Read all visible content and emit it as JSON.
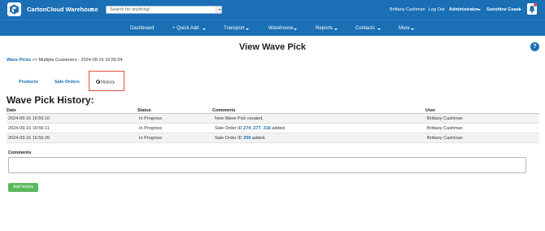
{
  "app": {
    "brand": "CartonCloud Warehouse",
    "logo_icon": "cartoncloud-cube-logo",
    "accent_color": "#1a6fb5"
  },
  "search": {
    "placeholder": "Search for anything!"
  },
  "topbar": {
    "user": "Brittany Cashman",
    "logout": "Log Out",
    "role": "Administrator",
    "warehouse": "Sunshine Coast",
    "notification_icon": "bell-icon"
  },
  "nav": {
    "dashboard": "Dashboard",
    "quick_add": "+ Quick Add",
    "transport": "Transport",
    "warehouse": "Warehouse",
    "reports": "Reports",
    "contacts": "Contacts",
    "more": "More"
  },
  "page": {
    "title": "View Wave Pick",
    "help": "?"
  },
  "breadcrumb": {
    "link": "Wave Picks",
    "separator": ">>",
    "current": "Multiple Customers - 2024-09-16 16:55:54"
  },
  "tabs": {
    "products": "Products",
    "sale_orders": "Sale Orders",
    "history": "History",
    "active": "History"
  },
  "history": {
    "title": "Wave Pick History:",
    "columns": {
      "date": "Date",
      "status": "Status",
      "comments": "Comments",
      "user": "User"
    },
    "rows": [
      {
        "date": "2024-09-16 16:56:10",
        "status": "In Progress",
        "comment_text": "New Wave Pick created.",
        "user": "Brittany Cashman"
      },
      {
        "date": "2024-09-16 16:56:11",
        "status": "In Progress",
        "comment_prefix": "Sale Order ID",
        "ids": [
          "274",
          "277",
          "318"
        ],
        "comment_suffix": "added.",
        "user": "Brittany Cashman"
      },
      {
        "date": "2024-09-16 16:56:26",
        "status": "In Progress",
        "comment_prefix": "Sale Order ID",
        "ids": [
          "259"
        ],
        "comment_suffix": "added.",
        "user": "Brittany Cashman"
      }
    ]
  },
  "form": {
    "comments_label": "Comments",
    "comments_value": "",
    "add_button": "Add history",
    "add_button_color": "#5cb85c"
  },
  "highlight": {
    "color": "#e04c3b"
  }
}
